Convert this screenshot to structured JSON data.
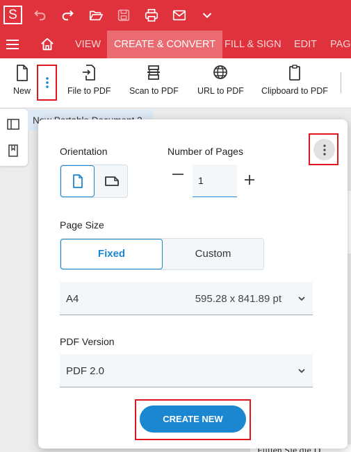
{
  "app": {
    "logo_letter": "S"
  },
  "tabs": [
    "VIEW",
    "CREATE & CONVERT",
    "FILL & SIGN",
    "EDIT",
    "PAGE"
  ],
  "toolbar": {
    "new_label": "New",
    "file_to_pdf_label": "File to PDF",
    "scan_to_pdf_label": "Scan to PDF",
    "url_to_pdf_label": "URL to PDF",
    "clipboard_to_pdf_label": "Clipboard to PDF"
  },
  "document": {
    "tab_title": "New Portable Document 2",
    "page_text": "Füllen Sie die D"
  },
  "dialog": {
    "orientation_label": "Orientation",
    "pages_label": "Number of Pages",
    "pages_value": "1",
    "page_size_label": "Page Size",
    "size_fixed": "Fixed",
    "size_custom": "Custom",
    "paper_size": "A4",
    "paper_dimensions": "595.28 x 841.89 pt",
    "pdf_version_label": "PDF Version",
    "pdf_version": "PDF 2.0",
    "create_button": "CREATE NEW"
  },
  "colors": {
    "brand": "#e0323c",
    "accent": "#1b87d1",
    "highlight": "#e0161e"
  }
}
